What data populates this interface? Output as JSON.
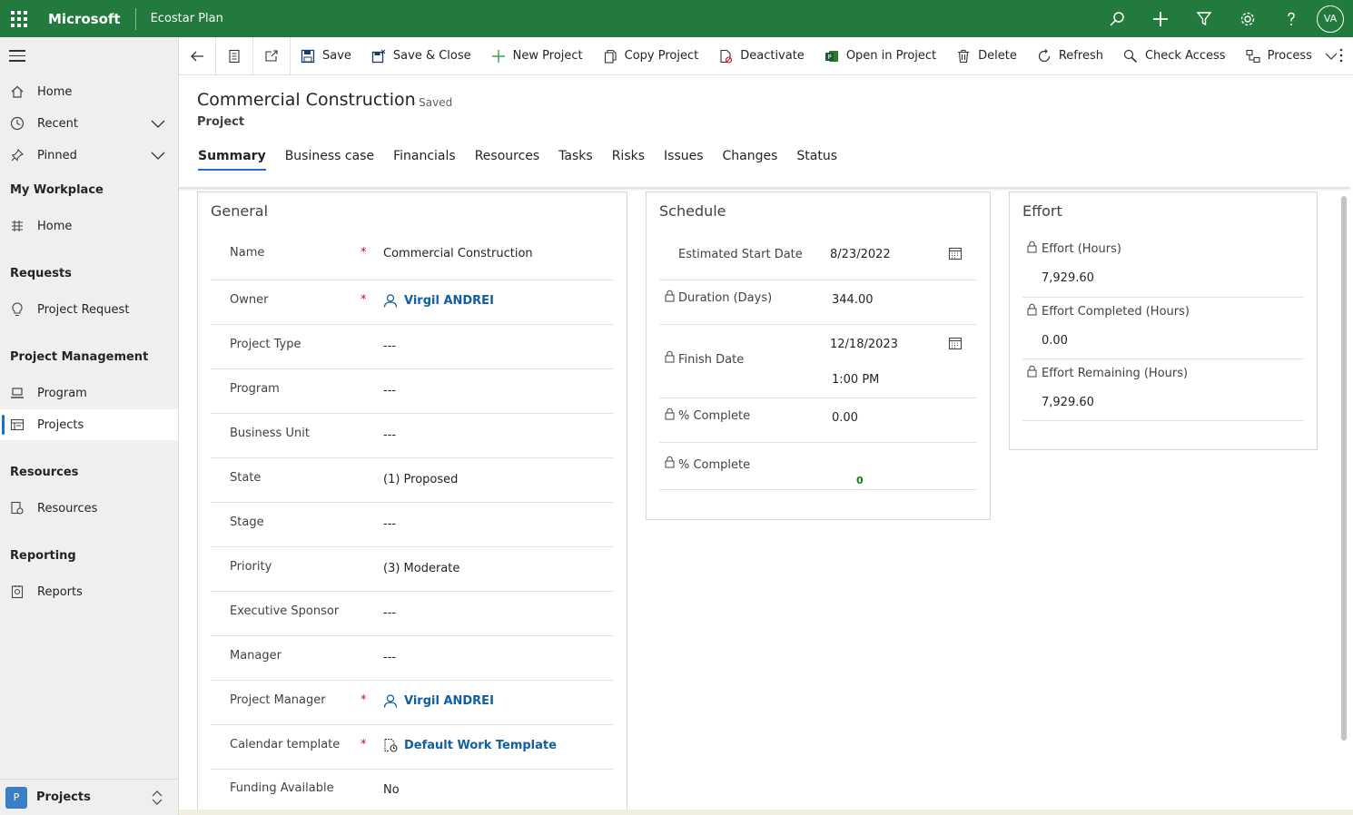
{
  "header": {
    "brand": "Microsoft",
    "app_name": "Ecostar Plan",
    "avatar_initials": "VA",
    "color": "#227a3e"
  },
  "sidebar": {
    "top_items": [
      {
        "label": "Home",
        "icon": "home-icon"
      },
      {
        "label": "Recent",
        "icon": "clock-icon"
      },
      {
        "label": "Pinned",
        "icon": "pin-icon"
      }
    ],
    "groups": [
      {
        "title": "My Workplace",
        "items": [
          {
            "label": "Home",
            "icon": "dashboard-icon"
          }
        ]
      },
      {
        "title": "Requests",
        "items": [
          {
            "label": "Project Request",
            "icon": "lightbulb-icon"
          }
        ]
      },
      {
        "title": "Project Management",
        "items": [
          {
            "label": "Program",
            "icon": "laptop-icon"
          },
          {
            "label": "Projects",
            "icon": "projects-icon",
            "active": true
          }
        ]
      },
      {
        "title": "Resources",
        "items": [
          {
            "label": "Resources",
            "icon": "resource-icon"
          }
        ]
      },
      {
        "title": "Reporting",
        "items": [
          {
            "label": "Reports",
            "icon": "report-icon"
          }
        ]
      }
    ],
    "area": {
      "badge": "P",
      "label": "Projects"
    }
  },
  "commands": [
    {
      "label": "Save",
      "icon": "save-icon"
    },
    {
      "label": "Save & Close",
      "icon": "save-close-icon"
    },
    {
      "label": "New Project",
      "icon": "plus-icon"
    },
    {
      "label": "Copy Project",
      "icon": "copy-icon"
    },
    {
      "label": "Deactivate",
      "icon": "deactivate-icon"
    },
    {
      "label": "Open in Project",
      "icon": "project-app-icon"
    },
    {
      "label": "Delete",
      "icon": "trash-icon"
    },
    {
      "label": "Refresh",
      "icon": "refresh-icon"
    },
    {
      "label": "Check Access",
      "icon": "check-access-icon"
    },
    {
      "label": "Process",
      "icon": "process-icon"
    }
  ],
  "record": {
    "title": "Commercial Construction",
    "status": "- Saved",
    "entity": "Project"
  },
  "tabs": [
    "Summary",
    "Business case",
    "Financials",
    "Resources",
    "Tasks",
    "Risks",
    "Issues",
    "Changes",
    "Status"
  ],
  "general": {
    "title": "General",
    "fields": [
      {
        "label": "Name",
        "value": "Commercial Construction",
        "required": true
      },
      {
        "label": "Owner",
        "value": "Virgil ANDREI",
        "required": true,
        "link": true,
        "icon": "user-icon"
      },
      {
        "label": "Project Type",
        "value": "---"
      },
      {
        "label": "Program",
        "value": "---"
      },
      {
        "label": "Business Unit",
        "value": "---"
      },
      {
        "label": "State",
        "value": "(1) Proposed"
      },
      {
        "label": "Stage",
        "value": "---"
      },
      {
        "label": "Priority",
        "value": "(3) Moderate"
      },
      {
        "label": "Executive Sponsor",
        "value": "---"
      },
      {
        "label": "Manager",
        "value": "---"
      },
      {
        "label": "Project Manager",
        "value": "Virgil ANDREI",
        "required": true,
        "link": true,
        "icon": "user-icon"
      },
      {
        "label": "Calendar template",
        "value": "Default Work Template",
        "required": true,
        "link": true,
        "icon": "calendar-template-icon"
      },
      {
        "label": "Funding Available",
        "value": "No"
      }
    ]
  },
  "schedule": {
    "title": "Schedule",
    "start_label": "Estimated Start Date",
    "start_value": "8/23/2022",
    "duration_label": "Duration (Days)",
    "duration_value": "344.00",
    "finish_label": "Finish Date",
    "finish_date": "12/18/2023",
    "finish_time": "1:00 PM",
    "pct_label": "% Complete",
    "pct_value": "0.00",
    "pct2_label": "% Complete",
    "pct2_value": "0",
    "pct2_color": "#107c10"
  },
  "effort": {
    "title": "Effort",
    "fields": [
      {
        "label": "Effort (Hours)",
        "value": "7,929.60"
      },
      {
        "label": "Effort Completed (Hours)",
        "value": "0.00"
      },
      {
        "label": "Effort Remaining (Hours)",
        "value": "7,929.60"
      }
    ]
  }
}
